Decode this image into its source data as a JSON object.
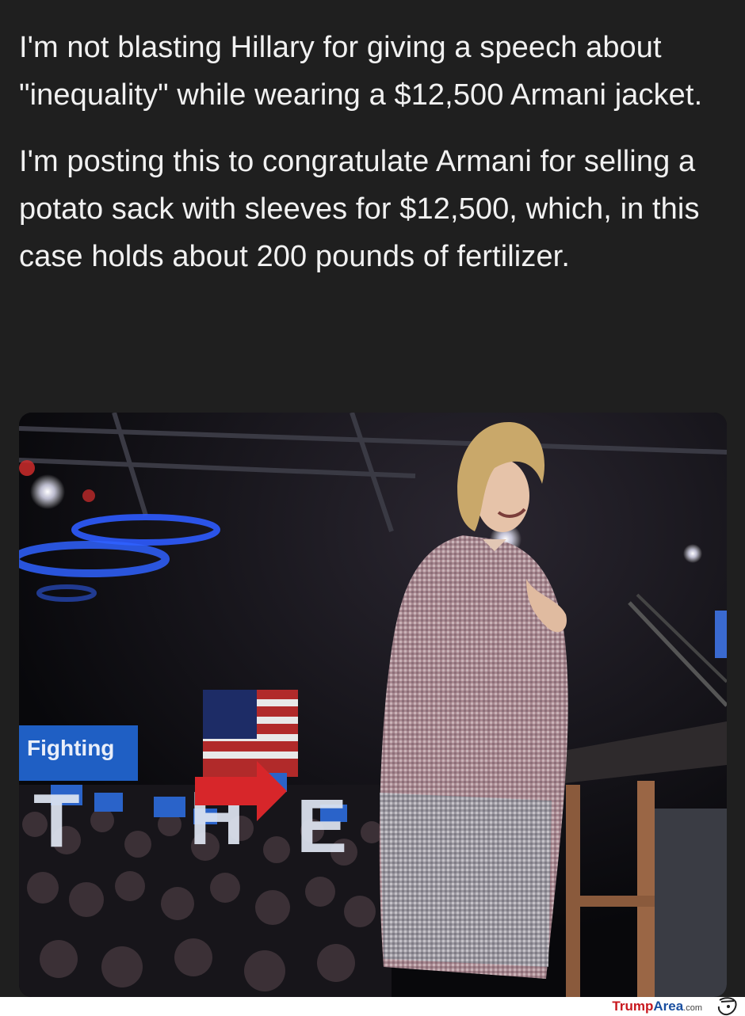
{
  "post": {
    "paragraph_1": "I'm not blasting Hillary for giving a speech about \"inequality\" while wearing a $12,500 Armani jacket.",
    "paragraph_2": "I'm posting this to congratulate Armani for selling a potato sack with sleeves for $12,500, which, in this case holds about 200 pounds of fertilizer."
  },
  "photo": {
    "sign_text": "Fighting",
    "letters": [
      "T",
      "H",
      "E"
    ]
  },
  "watermark": {
    "part_1": "Trump",
    "part_2": "Area",
    "part_3": ".com"
  },
  "colors": {
    "background": "#1f1f1f",
    "text": "#f1f1f1",
    "watermark_red": "#c8181e",
    "watermark_blue": "#1a4fa0",
    "campaign_blue": "#1f5fc4"
  }
}
